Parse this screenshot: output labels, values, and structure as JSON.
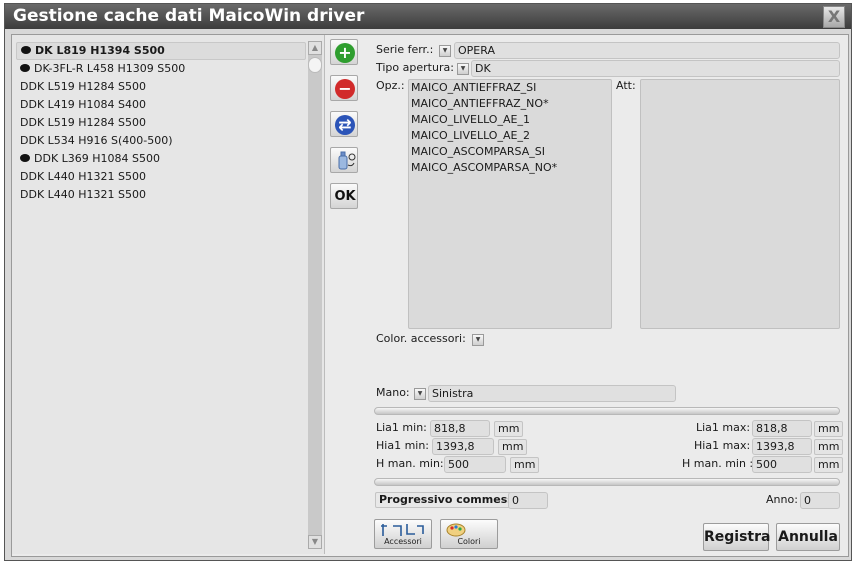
{
  "window": {
    "title": "Gestione cache dati MaicoWin driver",
    "close_label": "X"
  },
  "list": {
    "items": [
      {
        "label": "DK L819 H1394 S500",
        "bullet": true,
        "selected": true
      },
      {
        "label": "DK-3FL-R L458 H1309 S500",
        "bullet": true,
        "selected": false
      },
      {
        "label": "DDK L519 H1284 S500",
        "bullet": false,
        "selected": false
      },
      {
        "label": "DDK L419 H1084 S400",
        "bullet": false,
        "selected": false
      },
      {
        "label": "DDK L519 H1284 S500",
        "bullet": false,
        "selected": false
      },
      {
        "label": "DDK L534 H916 S(400-500)",
        "bullet": false,
        "selected": false
      },
      {
        "label": "DDK L369 H1084 S500",
        "bullet": true,
        "selected": false
      },
      {
        "label": "DDK L440 H1321 S500",
        "bullet": false,
        "selected": false
      },
      {
        "label": "DDK L440 H1321 S500",
        "bullet": false,
        "selected": false
      }
    ]
  },
  "actions": {
    "add_icon": "+",
    "remove_icon": "−",
    "swap_icon": "⇄",
    "ok_label": "OK",
    "colors": {
      "add": "#2f9e2f",
      "remove": "#d12a2a",
      "swap": "#2b54b8"
    }
  },
  "form": {
    "serie_label": "Serie ferr.:",
    "serie_value": "OPERA",
    "tipo_label": "Tipo apertura:",
    "tipo_value": "DK",
    "opz_label": "Opz.:",
    "att_label": "Att:",
    "options": [
      "MAICO_ANTIEFFRAZ_SI",
      "MAICO_ANTIEFFRAZ_NO*",
      "MAICO_LIVELLO_AE_1",
      "MAICO_LIVELLO_AE_2",
      "MAICO_ASCOMPARSA_SI",
      "MAICO_ASCOMPARSA_NO*"
    ],
    "color_acc_label": "Color. accessori:",
    "mano_label": "Mano:",
    "mano_value": "Sinistra",
    "dims": {
      "lia1_min_label": "Lia1 min:",
      "lia1_min_value": "818,8",
      "hia1_min_label": "Hia1 min:",
      "hia1_min_value": "1393,8",
      "hman_min_label": "H man. min:",
      "hman_min_value": "500",
      "lia1_max_label": "Lia1 max:",
      "lia1_max_value": "818,8",
      "hia1_max_label": "Hia1 max:",
      "hia1_max_value": "1393,8",
      "hman_max_label": "H man. min :",
      "hman_max_value": "500",
      "unit": "mm"
    },
    "progressivo_label": "Progressivo commessa:",
    "progressivo_value": "0",
    "anno_label": "Anno:",
    "anno_value": "0"
  },
  "buttons": {
    "accessori": "Accessori",
    "colori": "Colori",
    "registra": "Registra",
    "annulla": "Annulla"
  }
}
